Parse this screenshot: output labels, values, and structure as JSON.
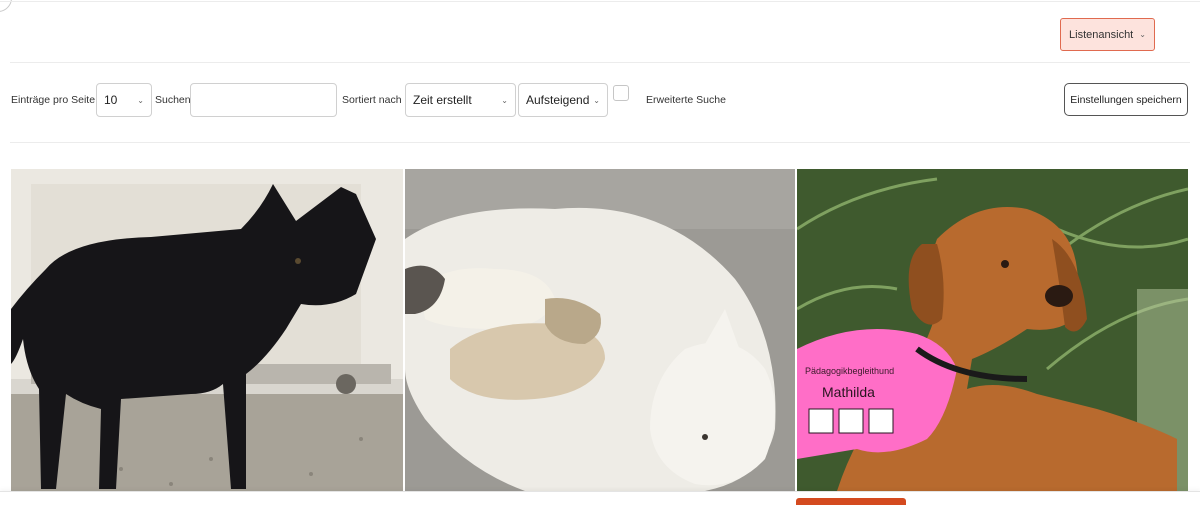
{
  "header": {
    "view_toggle_label": "Listenansicht"
  },
  "toolbar": {
    "entries_label": "Einträge pro Seite",
    "entries_value": "10",
    "search_label": "Suchen",
    "search_value": "",
    "sort_label": "Sortiert nach",
    "sort_field": "Zeit erstellt",
    "sort_order": "Aufsteigend",
    "advanced_search_label": "Erweiterte Suche",
    "save_settings_label": "Einstellungen speichern"
  },
  "gallery": {
    "items": [
      {
        "subject": "black dog standing in front of a white container"
      },
      {
        "subject": "white mother dog nursing puppies"
      },
      {
        "subject": "golden retriever in pink vest",
        "vest_text_top": "Pädagogikbegleithund",
        "vest_name": "Mathilda"
      }
    ]
  },
  "colors": {
    "accent": "#e06a4f",
    "accent_bg": "#fde3dd",
    "bottom_accent": "#d44a1f"
  }
}
